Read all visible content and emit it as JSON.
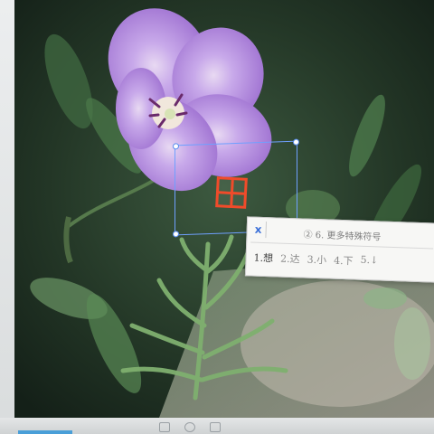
{
  "colors": {
    "selection_border": "#6fa0ff",
    "grid_icon": "#f04b2a",
    "petal": "#b38ad8",
    "foliage_dark": "#1f3224",
    "foliage_light": "#6f9a6a"
  },
  "icons": {
    "grid": "table-grid-icon",
    "ime_close": "x-close-icon",
    "ime_settings": "settings-circle-icon"
  },
  "ime": {
    "close": "x",
    "title_prefix": "②",
    "title": "6. 更多特殊符号",
    "candidates": [
      {
        "label": "1.想"
      },
      {
        "label": "2.达"
      },
      {
        "label": "3.小"
      },
      {
        "label": "4.下"
      },
      {
        "label": "5.↓"
      }
    ]
  }
}
